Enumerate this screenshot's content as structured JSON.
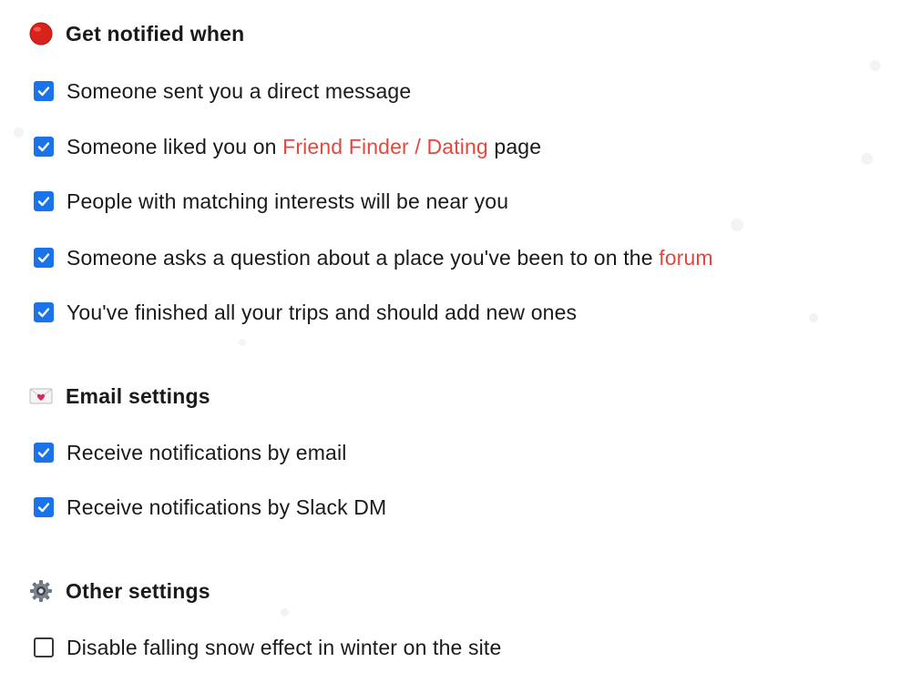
{
  "colors": {
    "checkbox_checked": "#1a73e8",
    "link": "#e5473d",
    "text": "#1a1a1a"
  },
  "sections": {
    "notify": {
      "icon": "red-circle-icon",
      "title": "Get notified when",
      "options": [
        {
          "label": "Someone sent you a direct message",
          "checked": true
        },
        {
          "before": "Someone liked you on ",
          "link": "Friend Finder / Dating",
          "after": " page",
          "checked": true
        },
        {
          "label": "People with matching interests will be near you",
          "checked": true
        },
        {
          "before": "Someone asks a question about a place you've been to on the ",
          "link": "forum",
          "checked": true
        },
        {
          "label": "You've finished all your trips and should add new ones",
          "checked": true
        }
      ]
    },
    "email": {
      "icon": "love-letter-icon",
      "title": "Email settings",
      "options": [
        {
          "label": "Receive notifications by email",
          "checked": true
        },
        {
          "label": "Receive notifications by Slack DM",
          "checked": true
        }
      ]
    },
    "other": {
      "icon": "gear-icon",
      "title": "Other settings",
      "options": [
        {
          "label": "Disable falling snow effect in winter on the site",
          "checked": false
        }
      ]
    }
  }
}
